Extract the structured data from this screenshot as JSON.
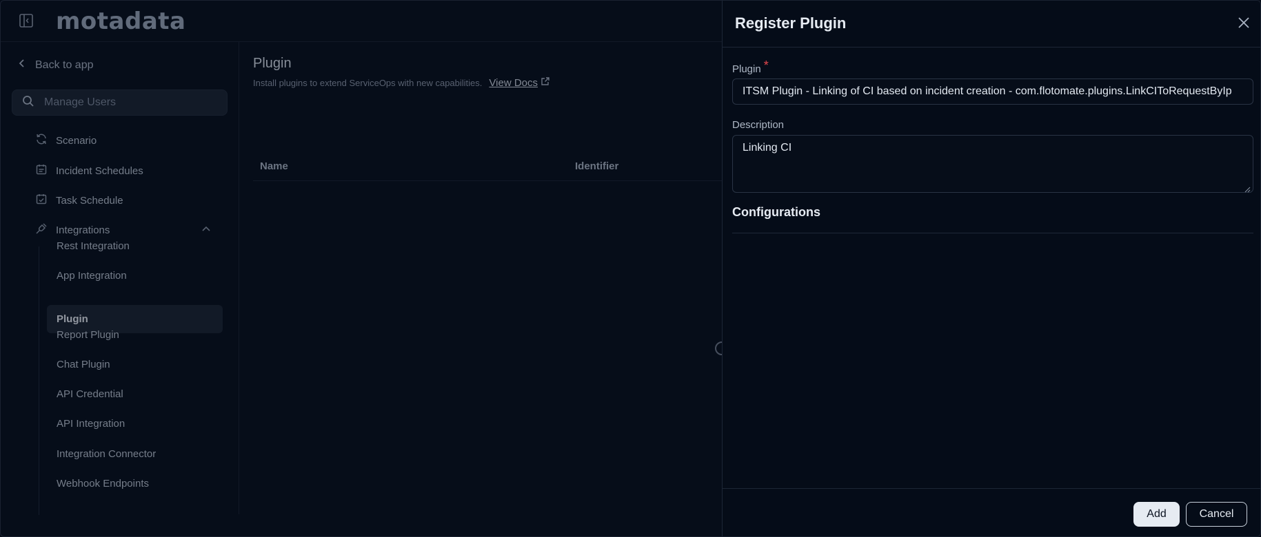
{
  "app": {
    "logo": "motadata"
  },
  "sidebar": {
    "back_label": "Back to app",
    "search_placeholder": "Manage Users",
    "items": [
      {
        "label": "Scenario",
        "icon": "refresh-icon"
      },
      {
        "label": "Incident Schedules",
        "icon": "calendar-list-icon"
      },
      {
        "label": "Task Schedule",
        "icon": "calendar-check-icon"
      },
      {
        "label": "Integrations",
        "icon": "plug-icon",
        "expanded": true
      }
    ],
    "sub_items": [
      {
        "label": "Rest Integration",
        "active": false
      },
      {
        "label": "App Integration",
        "active": false
      },
      {
        "label": "Plugin",
        "active": true
      },
      {
        "label": "Report Plugin",
        "active": false
      },
      {
        "label": "Chat Plugin",
        "active": false
      },
      {
        "label": "API Credential",
        "active": false
      },
      {
        "label": "API Integration",
        "active": false
      },
      {
        "label": "Integration Connector",
        "active": false
      },
      {
        "label": "Webhook Endpoints",
        "active": false
      }
    ]
  },
  "main": {
    "title": "Plugin",
    "subtitle": "Install plugins to extend ServiceOps with new capabilities.",
    "docs_link": "View Docs",
    "columns": [
      "Name",
      "Identifier"
    ]
  },
  "drawer": {
    "title": "Register Plugin",
    "plugin_label": "Plugin",
    "required_mark": "*",
    "plugin_value": "ITSM Plugin - Linking of CI based on incident creation  - com.flotomate.plugins.LinkCIToRequestByIp",
    "description_label": "Description",
    "description_value": "Linking CI",
    "configurations_title": "Configurations",
    "add_label": "Add",
    "cancel_label": "Cancel"
  }
}
